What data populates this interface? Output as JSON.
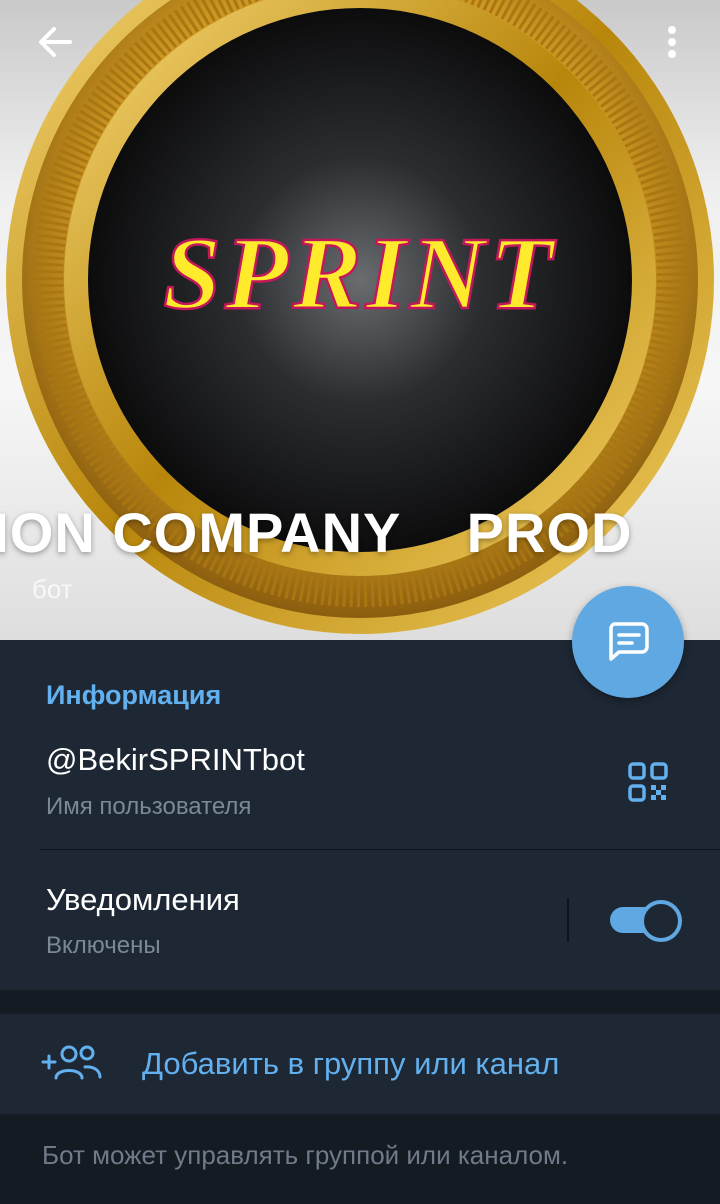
{
  "header": {
    "title": "TION COMPANY    PROD",
    "subtitle": "бот",
    "logo_text": "SPRINT",
    "back_icon": "arrow-left-icon",
    "menu_icon": "more-vertical-icon"
  },
  "fab": {
    "icon": "message-icon"
  },
  "info": {
    "section_title": "Информация",
    "username": "@BekirSPRINTbot",
    "username_caption": "Имя пользователя",
    "qr_icon": "qr-code-icon",
    "notifications_label": "Уведомления",
    "notifications_status": "Включены",
    "notifications_enabled": true
  },
  "actions": {
    "add_to_group_label": "Добавить в группу или канал",
    "add_icon": "add-users-icon"
  },
  "footer": {
    "text": "Бот может управлять группой или каналом."
  },
  "colors": {
    "accent": "#5fa8e2",
    "link": "#63b0ef",
    "background": "#1e2835",
    "separator": "#141b23",
    "logo_yellow": "#ffea2c",
    "gold": "#d6a92e"
  }
}
